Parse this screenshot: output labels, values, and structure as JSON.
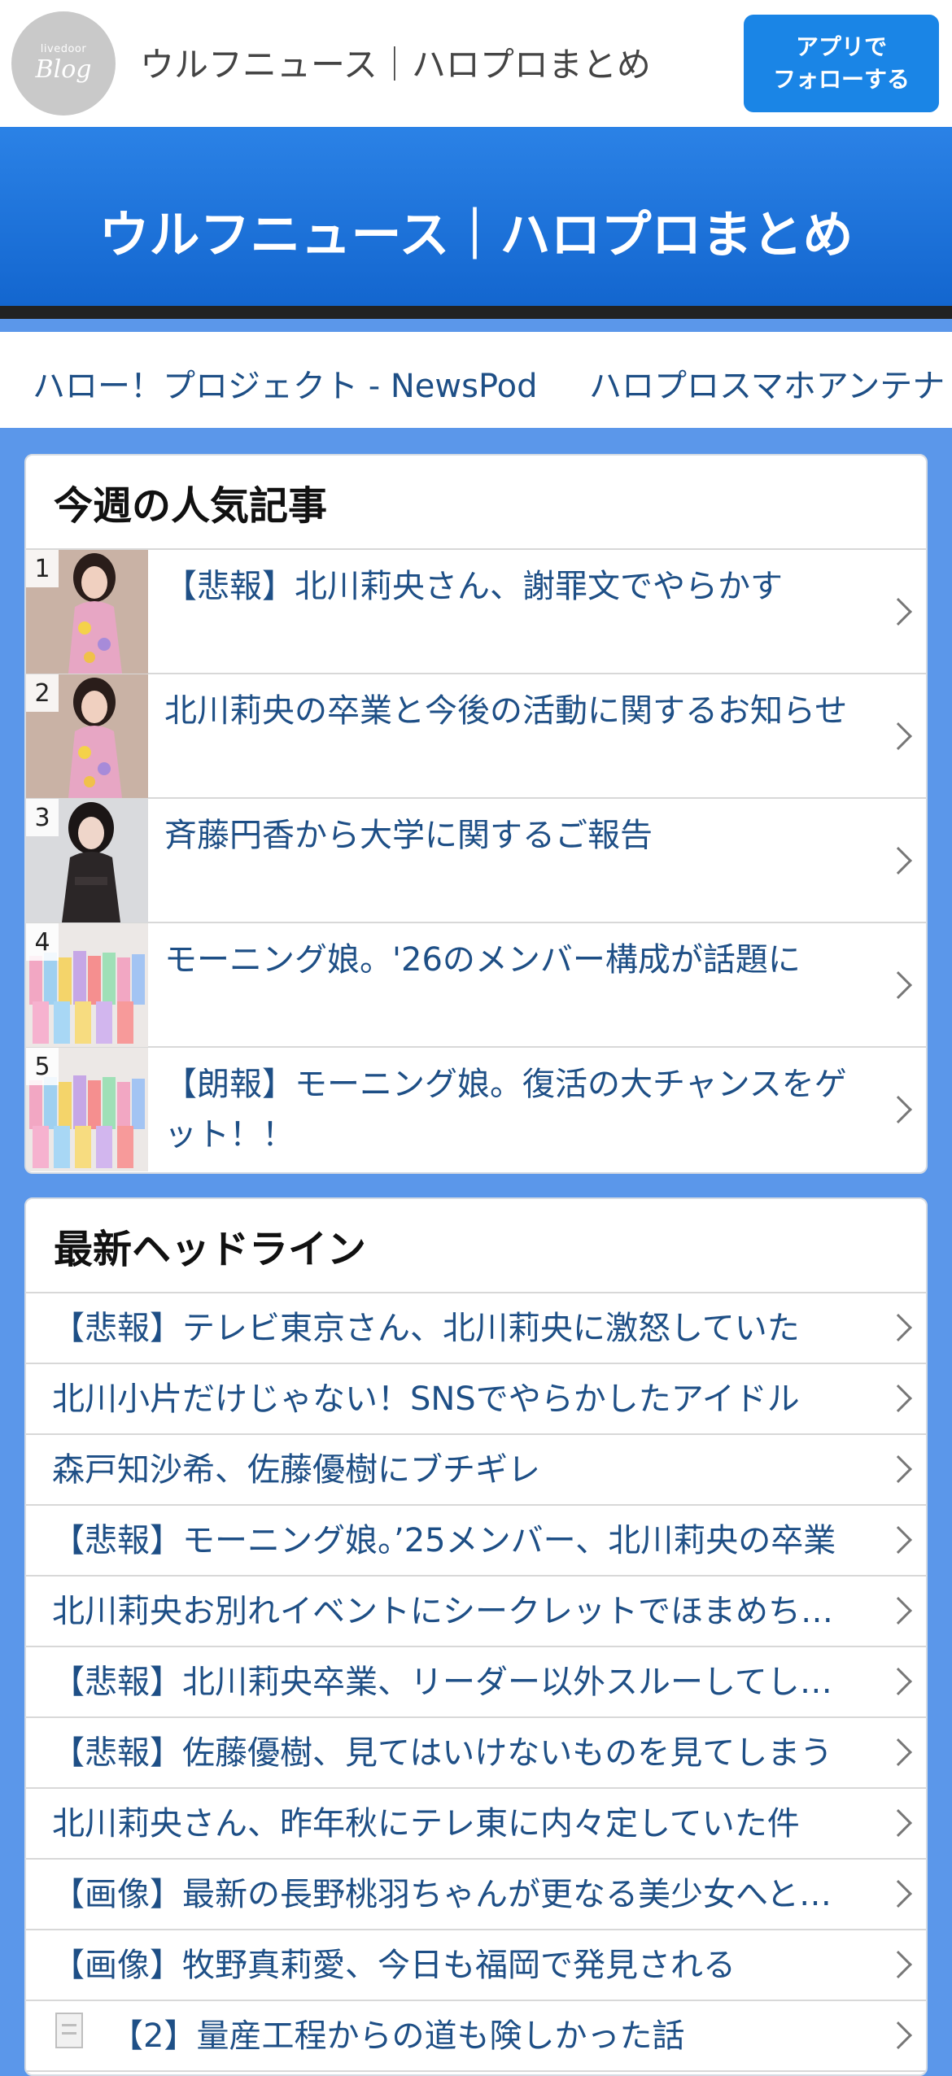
{
  "topbar": {
    "logo_small": "livedoor",
    "logo_big": "Blog",
    "title": "ウルフニュース｜ハロプロまとめ",
    "follow_button": "アプリで\nフォローする"
  },
  "banner": {
    "title": "ウルフニュース｜ハロプロまとめ"
  },
  "link_strip": [
    "ハロー！プロジェクト - NewsPod",
    "ハロプロスマホアンテナ"
  ],
  "weekly_popular": {
    "title": "今週の人気記事",
    "items": [
      {
        "rank": "1",
        "text": "【悲報】北川莉央さん、謝罪文でやらかす"
      },
      {
        "rank": "2",
        "text": "北川莉央の卒業と今後の活動に関するお知らせ"
      },
      {
        "rank": "3",
        "text": "斉藤円香から大学に関するご報告"
      },
      {
        "rank": "4",
        "text": "モーニング娘。'26のメンバー構成が話題に"
      },
      {
        "rank": "5",
        "text": "【朗報】モーニング娘。復活の大チャンスをゲット！！"
      }
    ]
  },
  "latest_headlines": {
    "title": "最新ヘッドライン",
    "items": [
      "【悲報】テレビ東京さん、北川莉央に激怒していた",
      "北川小片だけじゃない！SNSでやらかしたアイドル",
      "森戸知沙希、佐藤優樹にブチギレ",
      "【悲報】モーニング娘。’25メンバー、北川莉央の卒業",
      "北川莉央お別れイベントにシークレットでほまめちゃん",
      "【悲報】北川莉央卒業、リーダー以外スルーしてしまう",
      "【悲報】佐藤優樹、見てはいけないものを見てしまう",
      "北川莉央さん、昨年秋にテレ東に内々定していた件",
      "【画像】最新の長野桃羽ちゃんが更なる美少女へと進化",
      "【画像】牧野真莉愛、今日も福岡で発見される",
      "【2】量産工程からの道も険しかった話"
    ]
  },
  "colors": {
    "page_bg": "#5b97ea",
    "banner": "#1d74dc",
    "link_text": "#1e4f86",
    "follow_button": "#1a85e6"
  }
}
